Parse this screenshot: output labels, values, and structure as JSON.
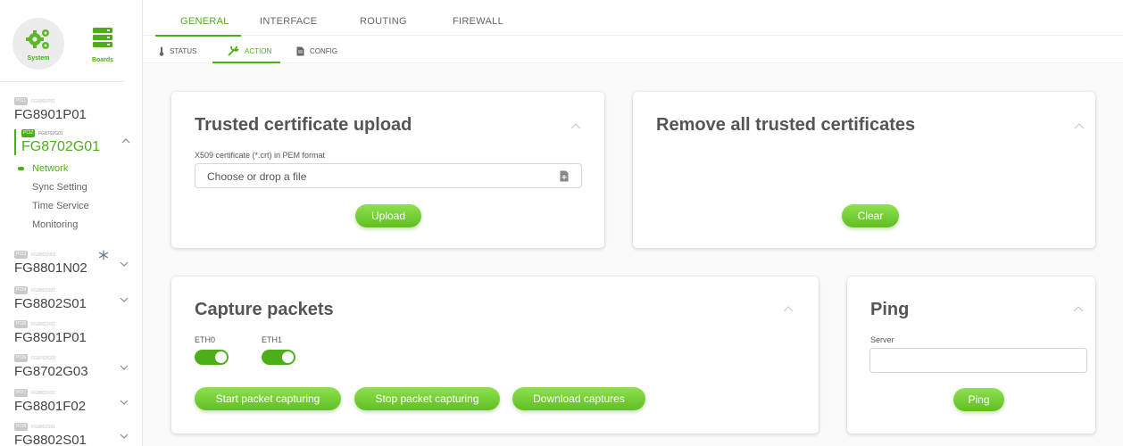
{
  "sidebar": {
    "system_label": "System",
    "boards_label": "Boards",
    "devices": [
      {
        "badge": "PCI1",
        "code": "FG8901P01",
        "name": "FG8901P01"
      },
      {
        "badge": "PCI2",
        "code": "FG8702G01",
        "name": "FG8702G01"
      },
      {
        "badge": "PCI3",
        "code": "FG8801N02",
        "name": "FG8801N02"
      },
      {
        "badge": "PCI4",
        "code": "FG8802S01",
        "name": "FG8802S01"
      },
      {
        "badge": "PCI5",
        "code": "FG8901P01",
        "name": "FG8901P01"
      },
      {
        "badge": "PCI6",
        "code": "FG8702G03",
        "name": "FG8702G03"
      },
      {
        "badge": "PCI7",
        "code": "FG8801F02",
        "name": "FG8801F02"
      },
      {
        "badge": "PCI8",
        "code": "FG8802S01",
        "name": "FG8802S01"
      }
    ],
    "submenu": [
      "Network",
      "Sync Setting",
      "Time Service",
      "Monitoring"
    ]
  },
  "topnav": {
    "tabs": [
      "GENERAL",
      "INTERFACE",
      "ROUTING",
      "FIREWALL"
    ]
  },
  "subnav": {
    "tabs": [
      "STATUS",
      "ACTION",
      "CONFIG"
    ]
  },
  "cards": {
    "upload": {
      "title": "Trusted certificate upload",
      "field_label": "X509 certificate (*.crt) in PEM format",
      "placeholder": "Choose or drop a file",
      "button": "Upload"
    },
    "remove": {
      "title": "Remove all trusted certificates",
      "button": "Clear"
    },
    "capture": {
      "title": "Capture packets",
      "eth0": "ETH0",
      "eth1": "ETH1",
      "btn_start": "Start packet capturing",
      "btn_stop": "Stop packet capturing",
      "btn_download": "Download captures"
    },
    "ping": {
      "title": "Ping",
      "server_label": "Server",
      "server_value": "",
      "button": "Ping"
    }
  },
  "colors": {
    "accent": "#4caf1a",
    "button_top": "#8fe04f",
    "button_bottom": "#5fbf22"
  }
}
